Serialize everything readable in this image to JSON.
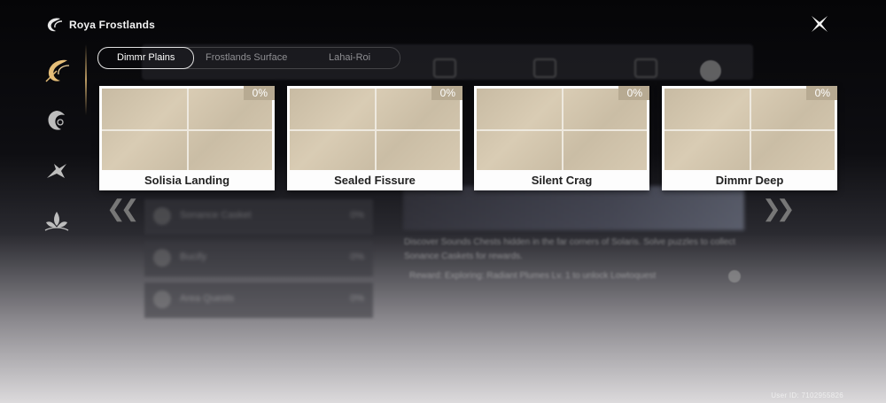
{
  "header": {
    "region_title": "Roya Frostlands"
  },
  "tabs": [
    {
      "label": "Dimmr Plains",
      "active": true
    },
    {
      "label": "Frostlands Surface",
      "active": false
    },
    {
      "label": "Lahai-Roi",
      "active": false
    }
  ],
  "sidebar": {
    "items": [
      {
        "icon": "feather-emblem-icon",
        "active": true
      },
      {
        "icon": "dragon-emblem-icon",
        "active": false
      },
      {
        "icon": "bird-emblem-icon",
        "active": false
      },
      {
        "icon": "lotus-emblem-icon",
        "active": false
      }
    ]
  },
  "cards": [
    {
      "label": "Solisia Landing",
      "percent": "0%"
    },
    {
      "label": "Sealed Fissure",
      "percent": "0%"
    },
    {
      "label": "Silent Crag",
      "percent": "0%"
    },
    {
      "label": "Dimmr Deep",
      "percent": "0%"
    }
  ],
  "background": {
    "rows": [
      {
        "label": "Sonance Casket",
        "percent": "0%"
      },
      {
        "label": "Bucify",
        "percent": "0%"
      },
      {
        "label": "Area Quests",
        "percent": "0%"
      }
    ],
    "description": "Discover Sounds Chests hidden in the far corners of Solaris. Solve puzzles to collect Sonance Caskets for rewards.",
    "reward_line": "Reward: Exploring: Radiant Plumes Lv. 1 to unlock Lowtoquest"
  },
  "footer": {
    "uid": "User ID: 7102955826"
  },
  "colors": {
    "accent_gold": "#e6be78",
    "percent_badge": "#b7aa92",
    "card_bg": "#fdfdfd"
  }
}
